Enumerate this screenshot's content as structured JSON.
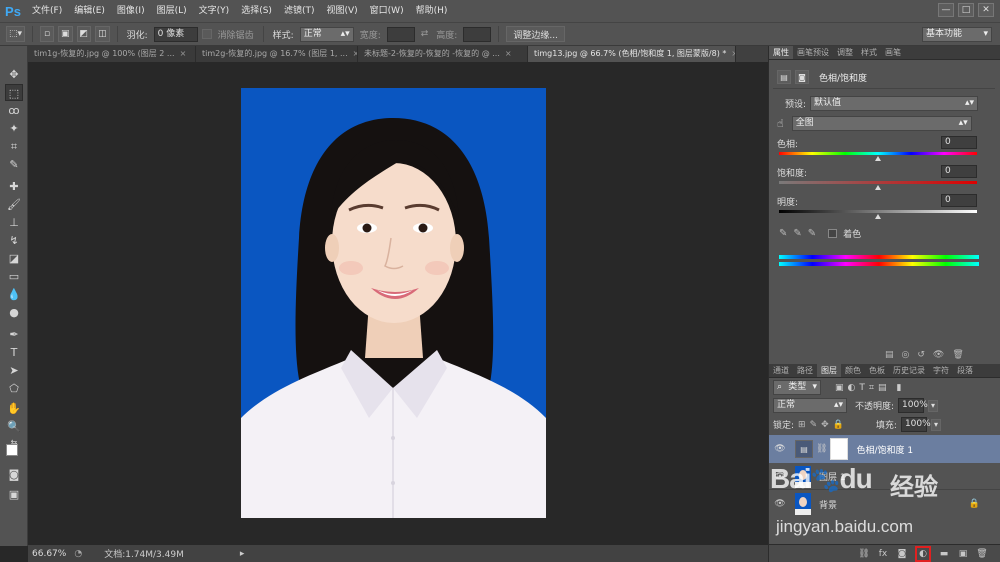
{
  "menubar": {
    "logo": "Ps",
    "items": [
      "文件(F)",
      "编辑(E)",
      "图像(I)",
      "图层(L)",
      "文字(Y)",
      "选择(S)",
      "滤镜(T)",
      "视图(V)",
      "窗口(W)",
      "帮助(H)"
    ],
    "window_controls": [
      "—",
      "□",
      "✕"
    ]
  },
  "options": {
    "feather_label": "羽化:",
    "feather_value": "0 像素",
    "antialias_label": "消除锯齿",
    "style_label": "样式:",
    "style_value": "正常",
    "width_label": "宽度:",
    "height_label": "高度:",
    "refine_label": "调整边缘...",
    "workspace": "基本功能"
  },
  "tabs": [
    {
      "label": "tim1g-恢复的.jpg @ 100% (图层 2 ...",
      "active": false
    },
    {
      "label": "tim2g-恢复的.jpg @ 16.7% (图层 1, ...",
      "active": false
    },
    {
      "label": "未标题-2-恢复的-恢复的 -恢复的 @ ...",
      "active": false
    },
    {
      "label": "timg13.jpg @ 66.7% (色相/饱和度 1, 图层蒙版/8) *",
      "active": true
    }
  ],
  "status": {
    "zoom": "66.67%",
    "doc": "文档:1.74M/3.49M"
  },
  "properties": {
    "tabs": [
      "属性",
      "画笔预设",
      "调整",
      "样式",
      "画笔"
    ],
    "title": "色相/饱和度",
    "preset_label": "预设:",
    "preset_value": "默认值",
    "channel_value": "全图",
    "hue_label": "色相:",
    "hue_value": "0",
    "saturation_label": "饱和度:",
    "saturation_value": "0",
    "lightness_label": "明度:",
    "lightness_value": "0",
    "colorize_label": "着色"
  },
  "layers": {
    "tabs": [
      "通道",
      "路径",
      "图层",
      "颜色",
      "色板",
      "历史记录",
      "字符",
      "段落"
    ],
    "filter_value": "类型",
    "blend_mode": "正常",
    "opacity_label": "不透明度:",
    "opacity_value": "100%",
    "lock_label": "锁定:",
    "fill_label": "填充:",
    "fill_value": "100%",
    "items": [
      {
        "name": "色相/饱和度 1",
        "selected": true
      },
      {
        "name": "图层 1",
        "selected": false
      },
      {
        "name": "背景",
        "selected": false
      }
    ]
  },
  "watermark": {
    "logo_text": "Bai",
    "logo_text2": "du",
    "chinese": "经验",
    "url": "jingyan.baidu.com"
  },
  "colors": {
    "photo_bg": "#0a56c1",
    "highlight": "#e02020"
  }
}
